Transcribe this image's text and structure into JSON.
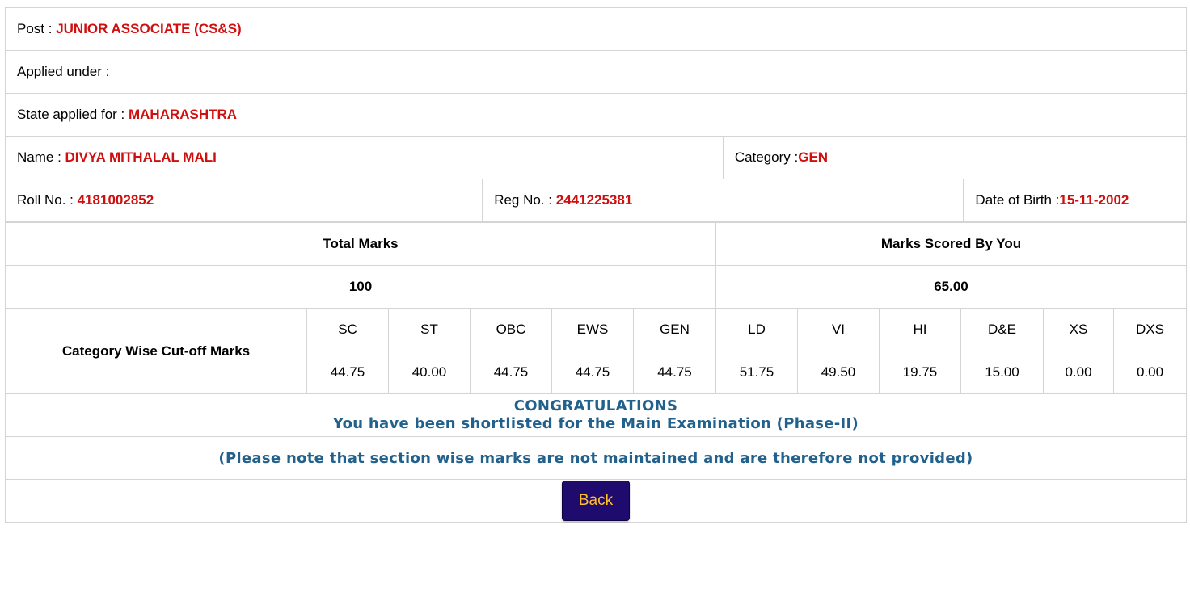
{
  "info": {
    "post_label": "Post : ",
    "post_value": "JUNIOR ASSOCIATE (CS&S)",
    "applied_label": "Applied under :",
    "state_label": "State applied for : ",
    "state_value": "MAHARASHTRA",
    "name_label": "Name : ",
    "name_value": "DIVYA MITHALAL MALI",
    "category_label": "Category :",
    "category_value": "GEN",
    "roll_label": "Roll No. : ",
    "roll_value": "4181002852",
    "reg_label": "Reg No. : ",
    "reg_value": "2441225381",
    "dob_label": "Date of Birth :",
    "dob_value": "15-11-2002"
  },
  "marks": {
    "total_header": "Total Marks",
    "scored_header": "Marks Scored By You",
    "total_value": "100",
    "scored_value": "65.00"
  },
  "cutoff": {
    "label": "Category Wise Cut-off Marks",
    "categories": [
      "SC",
      "ST",
      "OBC",
      "EWS",
      "GEN",
      "LD",
      "VI",
      "HI",
      "D&E",
      "XS",
      "DXS"
    ],
    "values": [
      "44.75",
      "40.00",
      "44.75",
      "44.75",
      "44.75",
      "51.75",
      "49.50",
      "19.75",
      "15.00",
      "0.00",
      "0.00"
    ]
  },
  "messages": {
    "congrats": "CONGRATULATIONS",
    "shortlisted": "You have been shortlisted for the Main Examination (Phase-II)",
    "note": "(Please note that section wise marks are not maintained and are therefore not provided)"
  },
  "actions": {
    "back_label": "Back"
  },
  "colors": {
    "value_red": "#d10f0f",
    "message_blue": "#21618c",
    "button_bg": "#1f0a6e",
    "button_text": "#ffc02a"
  }
}
